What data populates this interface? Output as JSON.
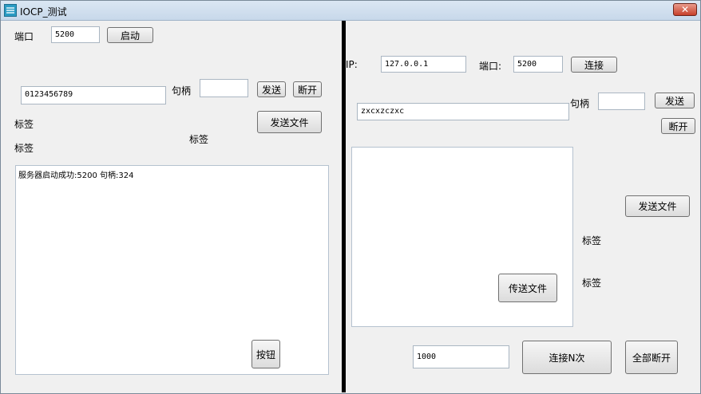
{
  "window": {
    "title": "IOCP_测试",
    "close_glyph": "✕"
  },
  "server": {
    "port_label": "端口",
    "port_value": "5200",
    "start_button": "启动",
    "send_text_value": "0123456789",
    "handle_label": "句柄",
    "handle_value": "",
    "send_button": "发送",
    "disconnect_button": "断开",
    "label_1": "标签",
    "send_file_button": "发送文件",
    "label_2": "标签",
    "label_3": "标签",
    "log_text": "服务器启动成功:5200  句柄:324",
    "button_label": "按钮"
  },
  "client": {
    "ip_label": "IP:",
    "ip_value": "127.0.0.1",
    "port_label": "端口:",
    "port_value": "5200",
    "connect_button": "连接",
    "send_text_value": "zxcxzczxc",
    "handle_label": "句柄",
    "handle_value": "",
    "send_button": "发送",
    "disconnect_button": "断开",
    "send_file_button": "发送文件",
    "label_1": "标签",
    "label_2": "标签",
    "transfer_file_button": "传送文件",
    "count_value": "1000",
    "connect_n_button": "连接N次",
    "disconnect_all_button": "全部断开"
  }
}
